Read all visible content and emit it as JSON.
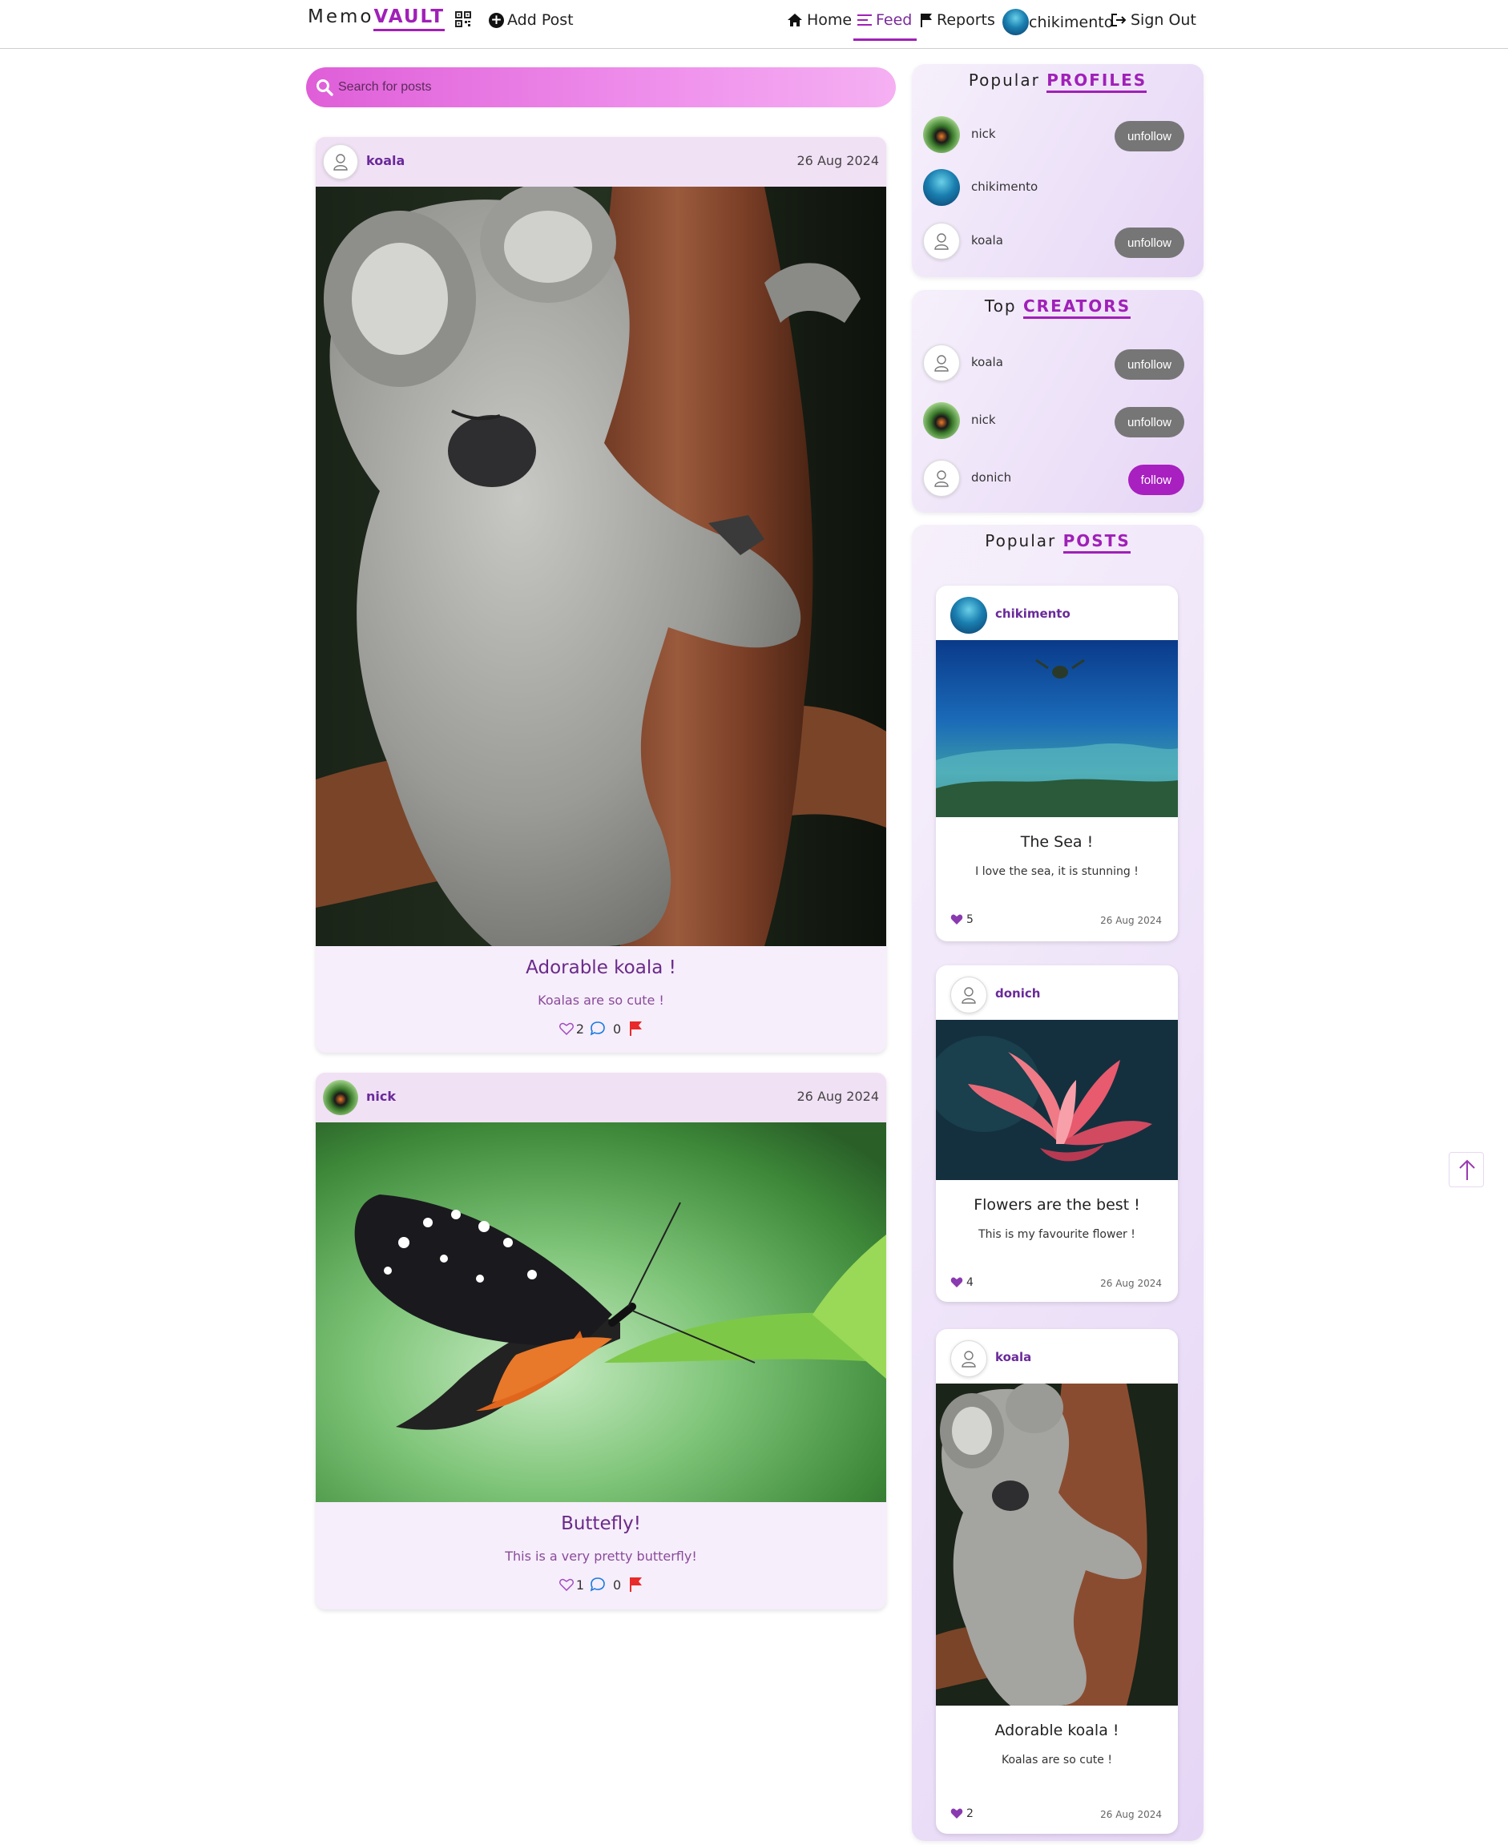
{
  "header": {
    "logo_prefix": "Memo",
    "logo_accent": "VAULT",
    "add_post": "Add Post",
    "nav": {
      "home": "Home",
      "feed": "Feed",
      "reports": "Reports",
      "user": "chikimento",
      "sign_out": "Sign Out"
    }
  },
  "search": {
    "placeholder": "Search for posts"
  },
  "posts": [
    {
      "user": "koala",
      "date": "26 Aug 2024",
      "title": "Adorable koala !",
      "description": "Koalas are so cute !",
      "likes": "2",
      "comments": "0"
    },
    {
      "user": "nick",
      "date": "26 Aug 2024",
      "title": "Buttefly!",
      "description": "This is a very pretty butterfly!",
      "likes": "1",
      "comments": "0"
    }
  ],
  "popular_profiles": {
    "title_prefix": "Popular",
    "title_accent": "PROFILES",
    "items": [
      {
        "name": "nick",
        "action": "unfollow"
      },
      {
        "name": "chikimento",
        "action": ""
      },
      {
        "name": "koala",
        "action": "unfollow"
      }
    ]
  },
  "top_creators": {
    "title_prefix": "Top",
    "title_accent": "CREATORS",
    "items": [
      {
        "name": "koala",
        "action": "unfollow"
      },
      {
        "name": "nick",
        "action": "unfollow"
      },
      {
        "name": "donich",
        "action": "follow"
      }
    ]
  },
  "popular_posts": {
    "title_prefix": "Popular",
    "title_accent": "POSTS",
    "items": [
      {
        "user": "chikimento",
        "title": "The Sea !",
        "description": "I love the sea, it is stunning !",
        "likes": "5",
        "date": "26 Aug 2024"
      },
      {
        "user": "donich",
        "title": "Flowers are the best !",
        "description": "This is my favourite flower !",
        "likes": "4",
        "date": "26 Aug 2024"
      },
      {
        "user": "koala",
        "title": "Adorable koala !",
        "description": "Koalas are so cute !",
        "likes": "2",
        "date": "26 Aug 2024"
      }
    ]
  },
  "colors": {
    "accent": "#a020b8",
    "follow_button": "#a820c0",
    "unfollow_button": "#767676",
    "search_gradient_start": "#df5ed8",
    "search_gradient_end": "#f5b0f2"
  },
  "icons": [
    "qr-code-icon",
    "plus-circle-icon",
    "home-icon",
    "list-icon",
    "flag-icon",
    "sign-out-icon",
    "search-icon",
    "heart-icon",
    "comment-icon",
    "report-flag-icon",
    "arrow-up-icon",
    "user-placeholder-icon"
  ]
}
